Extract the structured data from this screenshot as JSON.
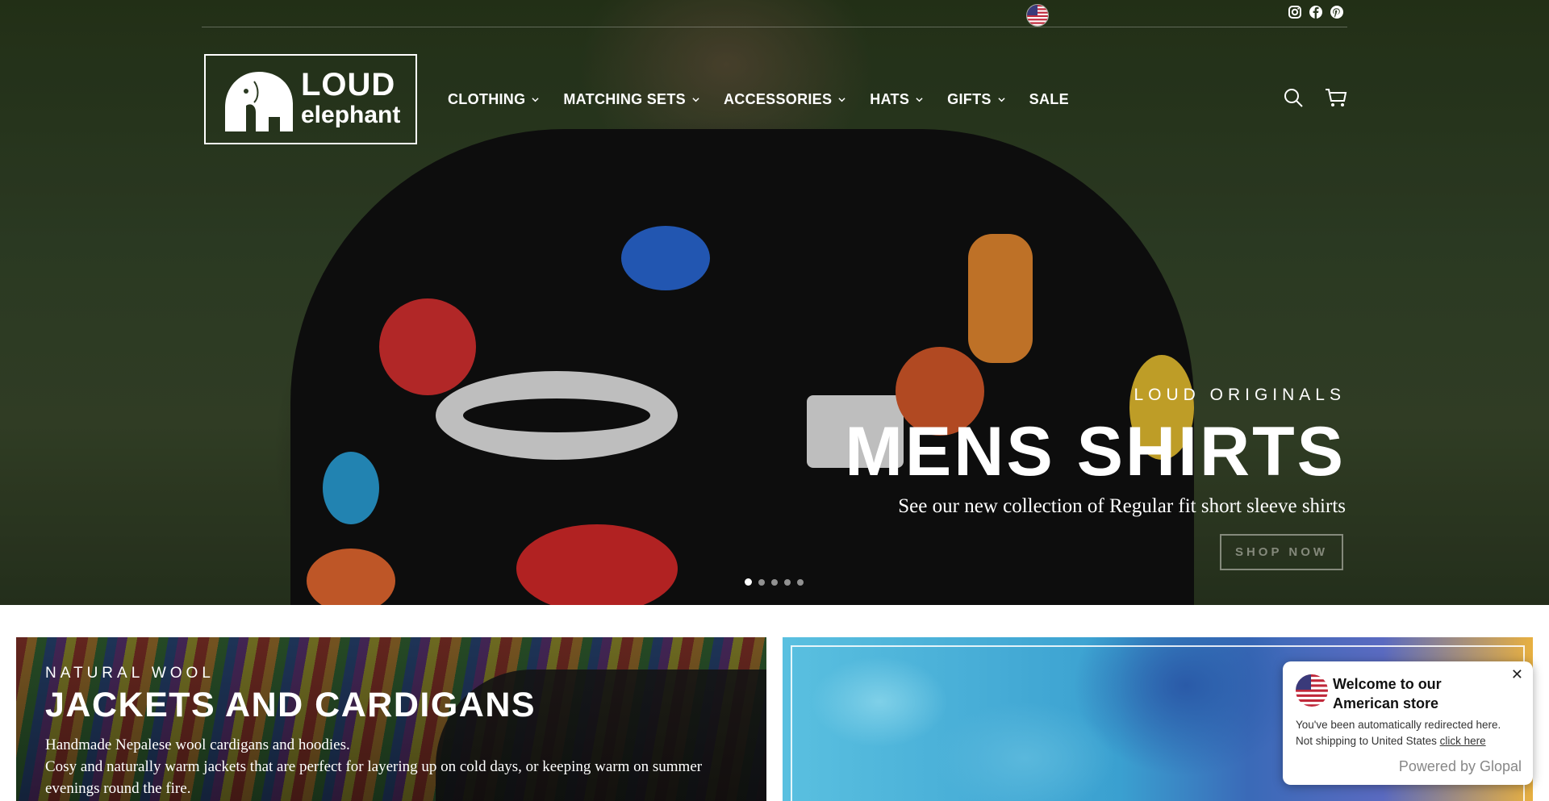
{
  "header": {
    "logo": {
      "line1": "LOUD",
      "line2": "elephant"
    },
    "nav": [
      {
        "label": "CLOTHING",
        "has_dropdown": true
      },
      {
        "label": "MATCHING SETS",
        "has_dropdown": true
      },
      {
        "label": "ACCESSORIES",
        "has_dropdown": true
      },
      {
        "label": "HATS",
        "has_dropdown": true
      },
      {
        "label": "GIFTS",
        "has_dropdown": true
      },
      {
        "label": "SALE",
        "has_dropdown": false
      }
    ],
    "icons": [
      "us-flag-icon",
      "instagram-icon",
      "facebook-icon",
      "pinterest-icon",
      "search-icon",
      "cart-icon"
    ]
  },
  "hero": {
    "kicker": "LOUD ORIGINALS",
    "title": "MENS SHIRTS",
    "description": "See our new collection of Regular fit short sleeve shirts",
    "button": "SHOP NOW",
    "slides_count": 5,
    "active_slide": 1
  },
  "tiles": [
    {
      "kicker": "NATURAL WOOL",
      "title": "JACKETS AND CARDIGANS",
      "desc1": "Handmade Nepalese wool cardigans and hoodies.",
      "desc2": "Cosy and naturally warm jackets that are perfect for layering up on cold days, or keeping warm on summer evenings round the fire."
    }
  ],
  "popup": {
    "title": "Welcome to our American store",
    "line1": "You've been automatically redirected here.",
    "line2_prefix": "Not shipping to United States ",
    "line2_link": "click here",
    "powered": "Powered by Glopal",
    "close": "✕"
  }
}
